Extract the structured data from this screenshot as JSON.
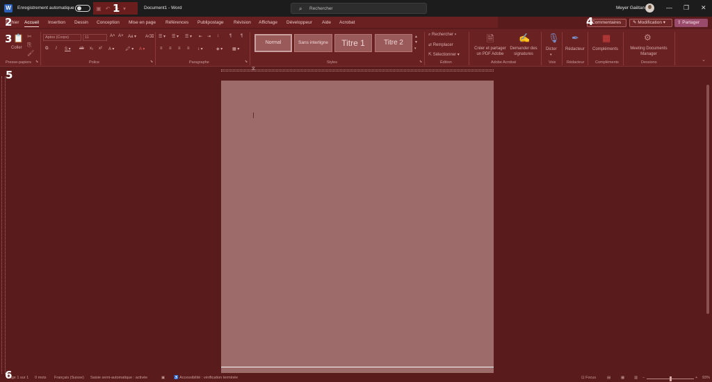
{
  "titlebar": {
    "autosave_label": "Enregistrement automatique",
    "doc_title": "Document1  -  Word",
    "search_placeholder": "Rechercher",
    "user_name": "Meyer Gaëtan",
    "minimize": "—",
    "restore": "❐",
    "close": "✕"
  },
  "tabs": [
    "Fichier",
    "Accueil",
    "Insertion",
    "Dessin",
    "Conception",
    "Mise en page",
    "Références",
    "Publipostage",
    "Révision",
    "Affichage",
    "Développeur",
    "Aide",
    "Acrobat"
  ],
  "actions": {
    "comments": "Commentaires",
    "edit_mode": "Modification",
    "share": "Partager"
  },
  "ribbon": {
    "clipboard": {
      "paste": "Coller",
      "label": "Presse-papiers"
    },
    "font": {
      "name": "Aptos (Corps)",
      "size": "11",
      "label": "Police"
    },
    "paragraph": {
      "label": "Paragraphe"
    },
    "styles": {
      "items": [
        "Normal",
        "Sans interligne",
        "Titre 1",
        "Titre 2"
      ],
      "label": "Styles"
    },
    "editing": {
      "find": "Rechercher",
      "replace": "Remplacer",
      "select": "Sélectionner",
      "label": "Édition"
    },
    "acrobat": {
      "create_share": "Créer et partager un PDF Adobe",
      "request_sign": "Demander des signatures",
      "label": "Adobe Acrobat"
    },
    "voice": {
      "dictate": "Dicter",
      "label": "Voix"
    },
    "editor": {
      "editor": "Rédacteur",
      "label": "Rédacteur"
    },
    "addins": {
      "addins": "Compléments",
      "label": "Compléments"
    },
    "dessions": {
      "meeting": "Meeting Documents Manager",
      "label": "Dessions"
    }
  },
  "status": {
    "page": "Page 1 sur 1",
    "words": "0 mots",
    "language": "Français (Suisse)",
    "prediction": "Saisie semi-automatique : activée",
    "accessibility": "Accessibilité : vérification terminée",
    "focus": "Focus",
    "zoom": "93%"
  },
  "markers": [
    "1",
    "2",
    "3",
    "4",
    "5",
    "6"
  ],
  "colors": {
    "overlay": "#5a1b1c",
    "ribbon": "#6a2121",
    "page": "#9c6b6a",
    "titlebar": "#1c1c1c"
  }
}
